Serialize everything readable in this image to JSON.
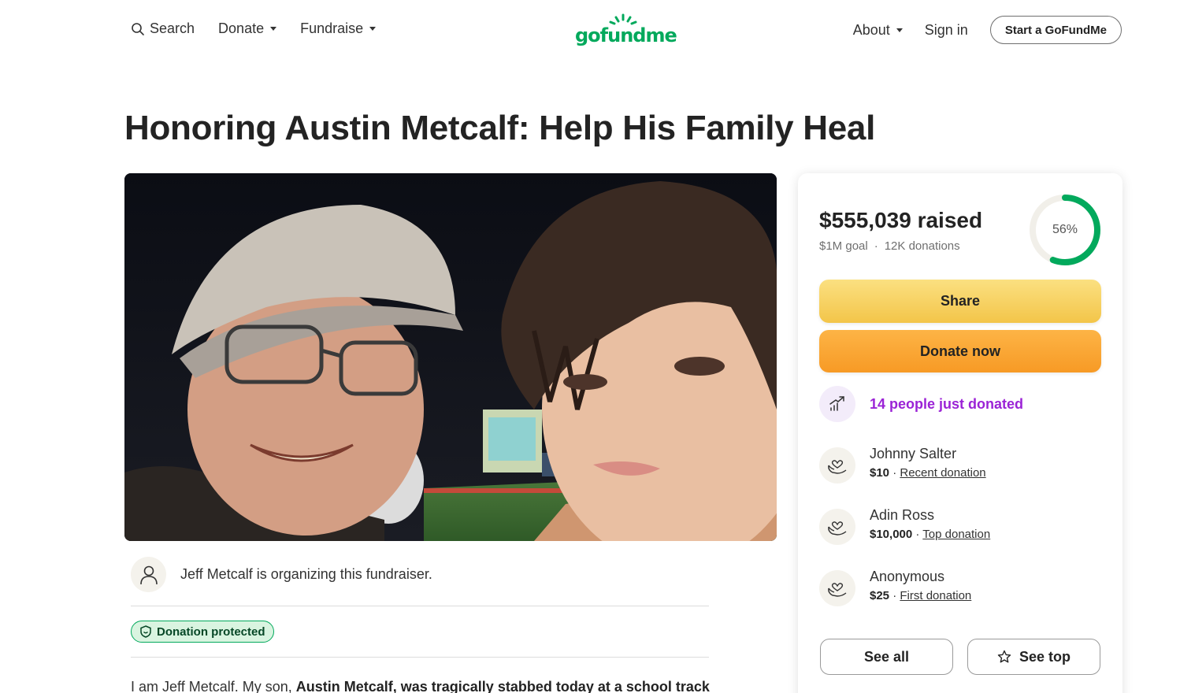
{
  "header": {
    "search_label": "Search",
    "donate_label": "Donate",
    "fundraise_label": "Fundraise",
    "logo_text": "gofundme",
    "about_label": "About",
    "signin_label": "Sign in",
    "start_label": "Start a GoFundMe"
  },
  "campaign": {
    "title": "Honoring Austin Metcalf: Help His Family Heal",
    "organizer_text": "Jeff Metcalf is organizing this fundraiser.",
    "protected_label": "Donation protected",
    "story_plain": "I am Jeff Metcalf. My son, ",
    "story_bold": "Austin Metcalf, was tragically stabbed today at a school track"
  },
  "stats": {
    "raised": "$555,039 raised",
    "goal": "$1M goal",
    "separator": "·",
    "donations": "12K donations",
    "percent_label": "56%",
    "percent_value": 0.56,
    "ring_color": "#02a95c"
  },
  "actions": {
    "share_label": "Share",
    "donate_now_label": "Donate now",
    "see_all_label": "See all",
    "see_top_label": "See top"
  },
  "activity": {
    "just_donated": "14 people just donated",
    "donors": [
      {
        "name": "Johnny Salter",
        "amount": "$10",
        "tag": "Recent donation"
      },
      {
        "name": "Adin Ross",
        "amount": "$10,000",
        "tag": "Top donation"
      },
      {
        "name": "Anonymous",
        "amount": "$25",
        "tag": "First donation"
      }
    ]
  }
}
